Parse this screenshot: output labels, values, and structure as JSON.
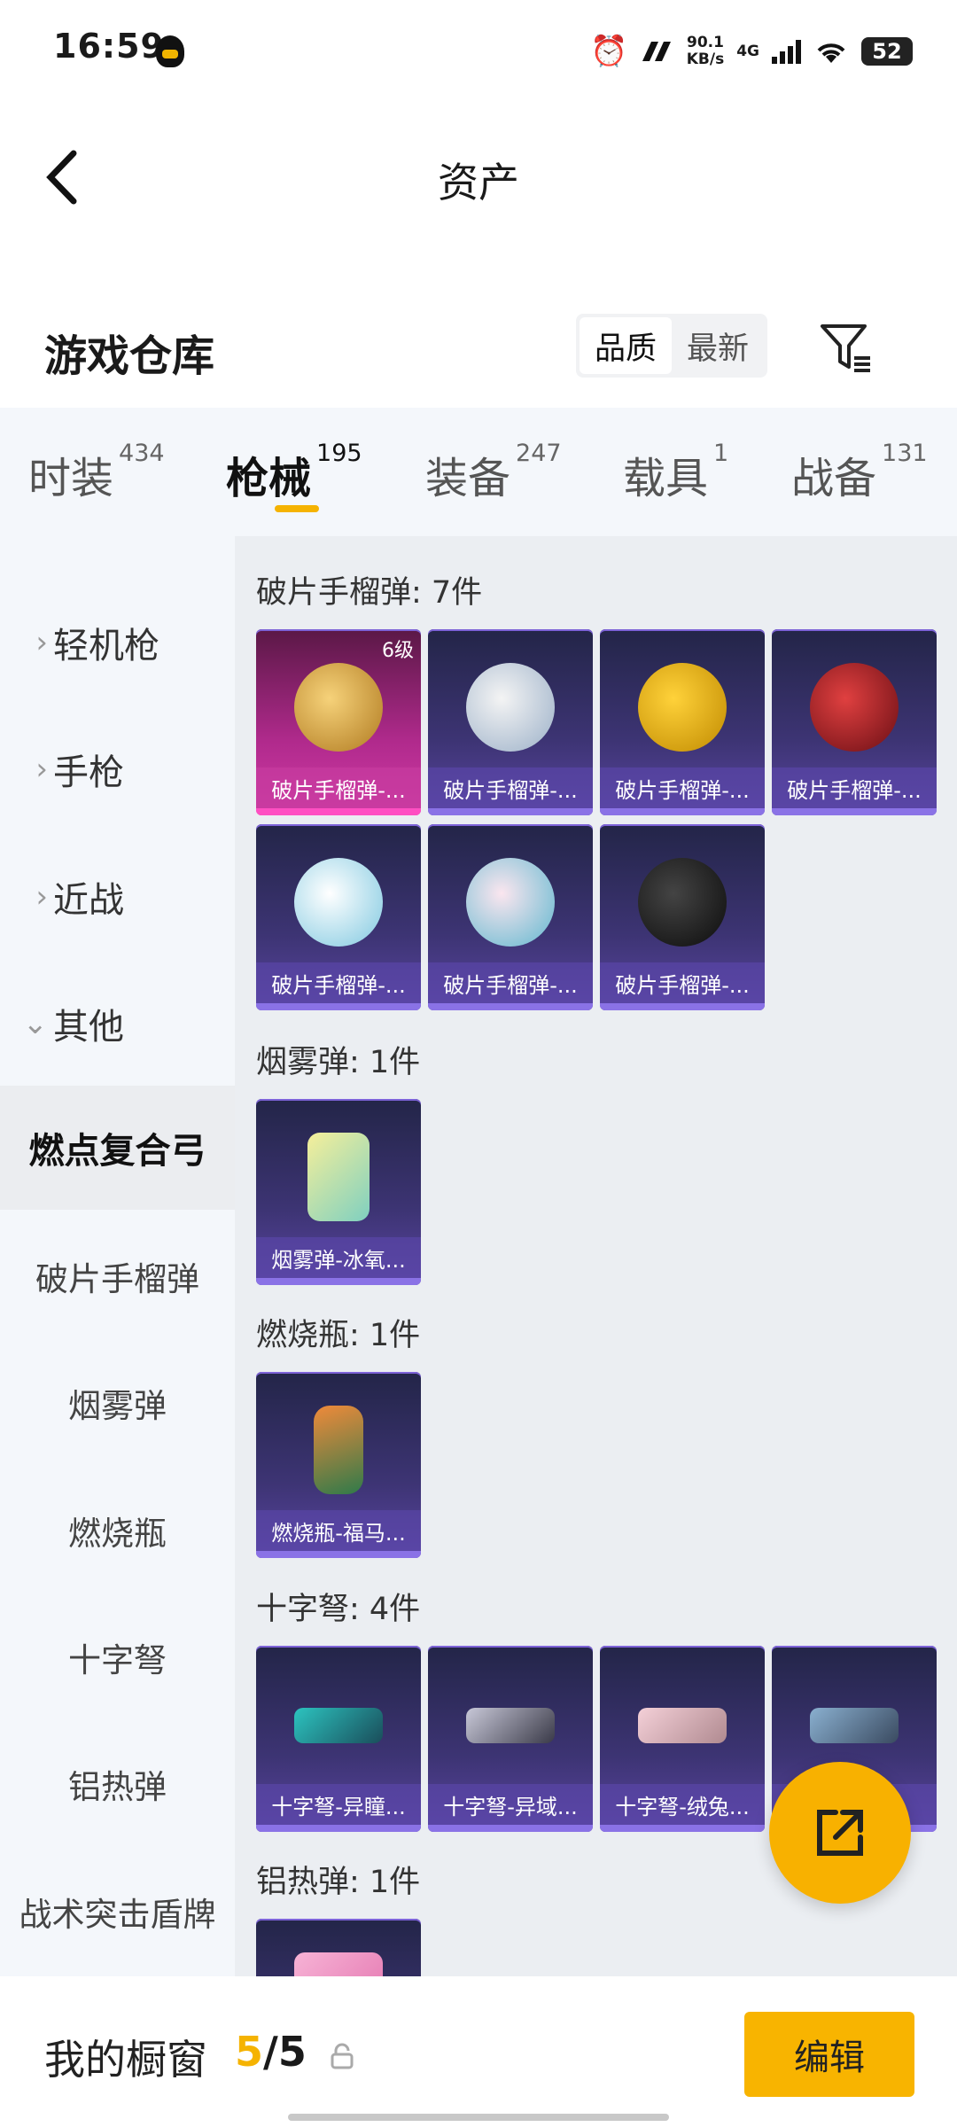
{
  "status": {
    "time": "16:59",
    "net_speed_value": "90.1",
    "net_speed_unit": "KB/s",
    "network": "4G",
    "battery": "52"
  },
  "header": {
    "title": "资产"
  },
  "title_row": {
    "title": "游戏仓库",
    "sort_options": [
      "品质",
      "最新"
    ]
  },
  "tabs": [
    {
      "label": "时装",
      "count": "434"
    },
    {
      "label": "枪械",
      "count": "195"
    },
    {
      "label": "装备",
      "count": "247"
    },
    {
      "label": "载具",
      "count": "1"
    },
    {
      "label": "战备",
      "count": "131"
    }
  ],
  "sidebar": {
    "groups": [
      "轻机枪",
      "手枪",
      "近战",
      "其他"
    ],
    "selected": "燃点复合弓",
    "subs": [
      "破片手榴弹",
      "烟雾弹",
      "燃烧瓶",
      "十字弩",
      "铝热弹",
      "战术突击盾牌"
    ]
  },
  "sections": [
    {
      "title": "破片手榴弹: 7件",
      "items": [
        "破片手榴弹-...",
        "破片手榴弹-...",
        "破片手榴弹-...",
        "破片手榴弹-...",
        "破片手榴弹-...",
        "破片手榴弹-...",
        "破片手榴弹-..."
      ],
      "level_badge": "6级"
    },
    {
      "title": "烟雾弹: 1件",
      "items": [
        "烟雾弹-冰氧..."
      ]
    },
    {
      "title": "燃烧瓶: 1件",
      "items": [
        "燃烧瓶-福马..."
      ]
    },
    {
      "title": "十字弩: 4件",
      "items": [
        "十字弩-异瞳...",
        "十字弩-异域...",
        "十字弩-绒兔...",
        "十字弩-..."
      ]
    },
    {
      "title": "铝热弹: 1件",
      "items": []
    }
  ],
  "bottom": {
    "label": "我的橱窗",
    "current": "5",
    "separator": "/",
    "total": "5",
    "edit": "编辑"
  },
  "colors": {
    "accent": "#f8b400",
    "card_purple": "#3d3474",
    "card_legend": "#b02a8c"
  }
}
